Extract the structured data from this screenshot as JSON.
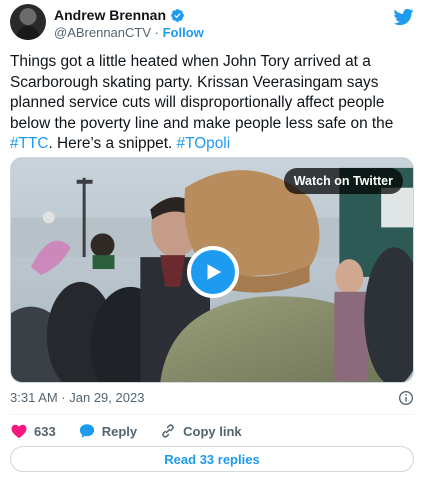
{
  "author": {
    "display_name": "Andrew Brennan",
    "handle": "@ABrennanCTV",
    "separator": " · ",
    "follow_label": "Follow"
  },
  "tweet": {
    "text_part1": "Things got a little heated when John Tory arrived at a Scarborough skating party. Krissan Veerasingam says planned service cuts will disproportionally affect people below the poverty line and make people less safe on the ",
    "hashtag1": "#TTC",
    "text_part2": ". Here’s a snippet. ",
    "hashtag2": "#TOpoli"
  },
  "media": {
    "watch_label": "Watch on Twitter"
  },
  "timestamp": "3:31 AM · Jan 29, 2023",
  "actions": {
    "like_count": "633",
    "reply_label": "Reply",
    "copy_link_label": "Copy link"
  },
  "read_replies_label": "Read 33 replies",
  "icons": {
    "verified": "verified-badge-icon",
    "brand": "twitter-bird-icon",
    "like": "heart-icon",
    "reply": "speech-bubble-icon",
    "copy": "link-icon",
    "info": "info-icon",
    "play": "play-icon"
  },
  "colors": {
    "accent": "#1d9bf0",
    "like": "#f91880",
    "text": "#0f1419",
    "secondary": "#536471"
  }
}
